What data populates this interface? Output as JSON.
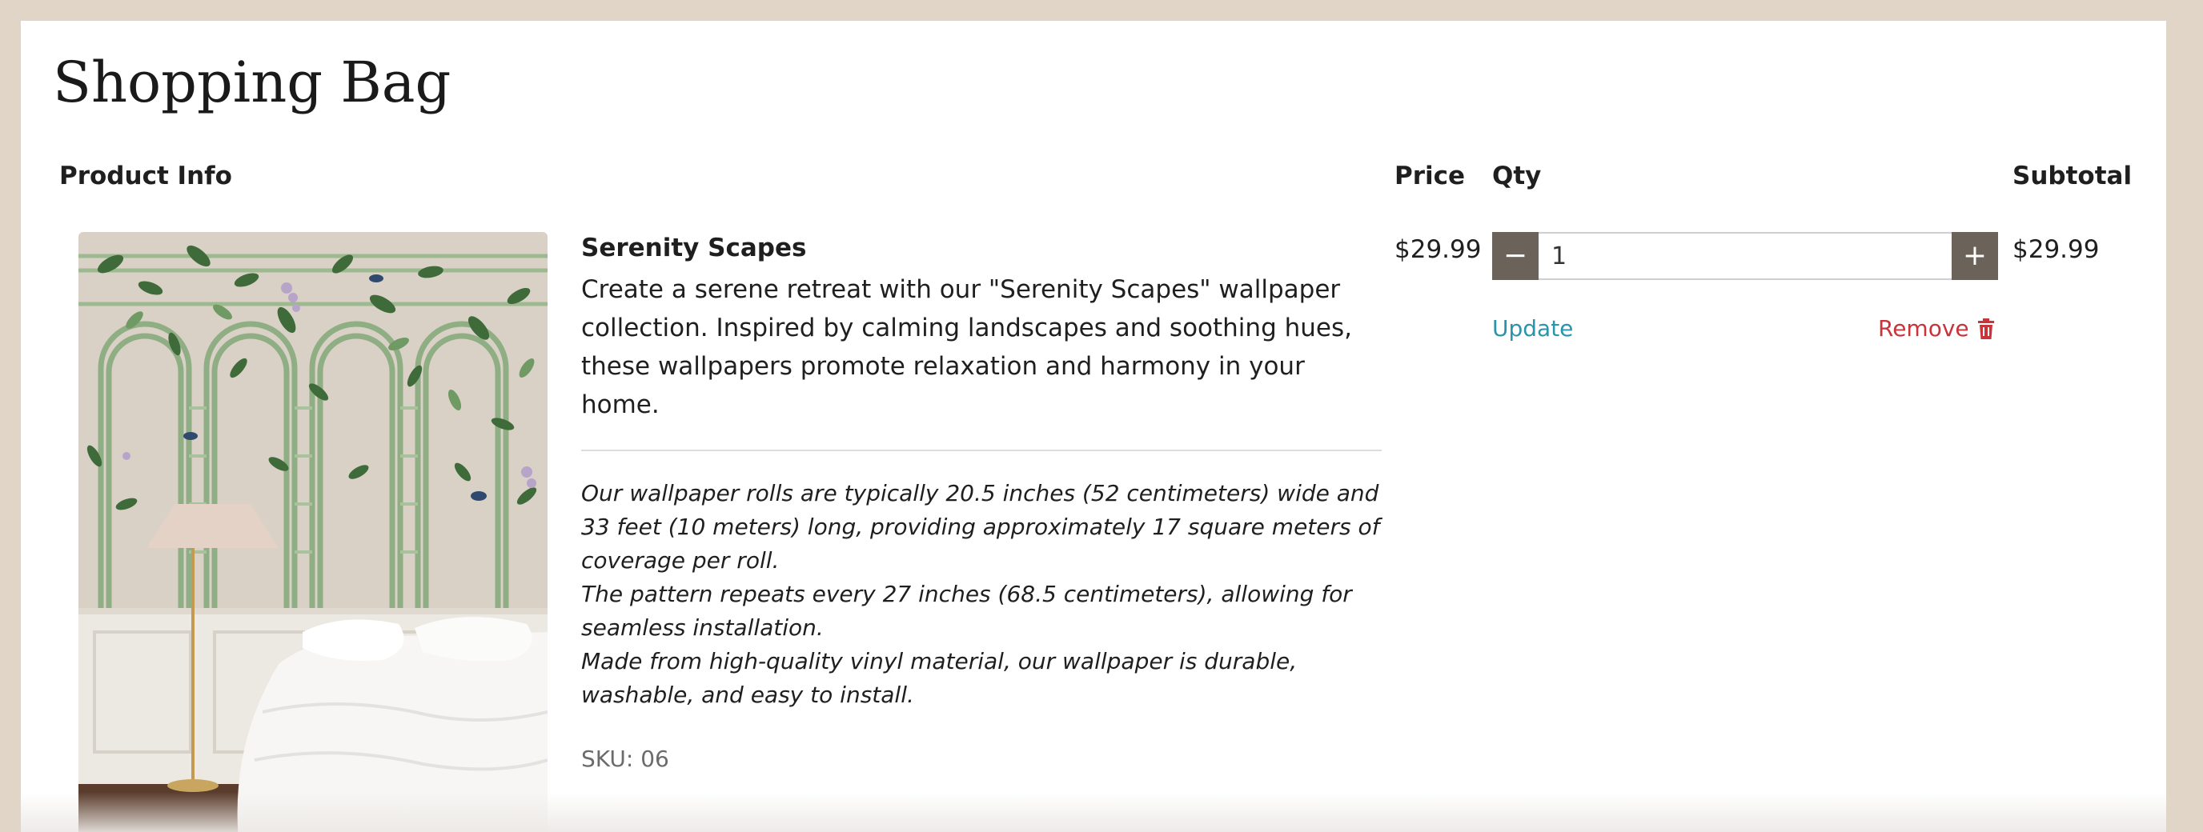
{
  "page": {
    "title": "Shopping Bag"
  },
  "table": {
    "headers": {
      "product_info": "Product Info",
      "price": "Price",
      "qty": "Qty",
      "subtotal": "Subtotal"
    }
  },
  "item": {
    "name": "Serenity Scapes",
    "description": "Create a serene retreat with our \"Serenity Scapes\" wallpaper collection. Inspired by calming landscapes and soothing hues, these wallpapers promote relaxation and harmony in your home.",
    "details": [
      "Our wallpaper rolls are typically 20.5 inches (52 centimeters) wide and 33 feet (10 meters) long, providing approximately 17 square meters of coverage per roll.",
      "The pattern repeats every 27 inches (68.5 centimeters), allowing for seamless installation.",
      "Made from high-quality vinyl material, our wallpaper is durable, washable, and easy to install."
    ],
    "sku": "SKU: 06",
    "price": "$29.99",
    "quantity": "1",
    "subtotal": "$29.99",
    "decrement_icon": "minus-icon",
    "increment_icon": "plus-icon",
    "decrement_label": "−",
    "increment_label": "+",
    "update_label": "Update",
    "remove_label": "Remove",
    "remove_icon": "trash-icon"
  },
  "colors": {
    "background": "#e1d5c7",
    "qty_button": "#6b625a",
    "update_link": "#2a93ad",
    "remove_link": "#c9343b"
  }
}
